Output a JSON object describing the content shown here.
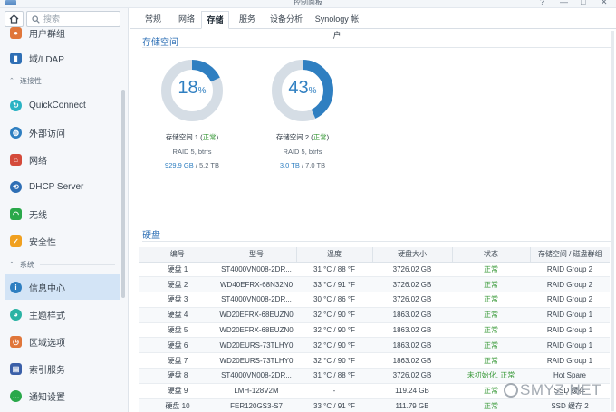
{
  "window": {
    "title": "控制面板",
    "controls": [
      "?",
      "—",
      "□",
      "✕"
    ]
  },
  "sidebar": {
    "search_placeholder": "搜索",
    "items": [
      {
        "label": "用户群组",
        "icon": "users-icon",
        "color": "#e0763a"
      },
      {
        "label": "域/LDAP",
        "icon": "directory-icon",
        "color": "#2f6fb5"
      },
      {
        "label": "QuickConnect",
        "icon": "quickconnect-icon",
        "color": "#2bb3c4"
      },
      {
        "label": "外部访问",
        "icon": "globe-icon",
        "color": "#2f7fc1"
      },
      {
        "label": "网络",
        "icon": "house-network-icon",
        "color": "#d44a3a"
      },
      {
        "label": "DHCP Server",
        "icon": "dhcp-icon",
        "color": "#2f6fb5"
      },
      {
        "label": "无线",
        "icon": "wifi-icon",
        "color": "#2aa84a"
      },
      {
        "label": "安全性",
        "icon": "shield-icon",
        "color": "#f0a020"
      },
      {
        "label": "信息中心",
        "icon": "info-icon",
        "color": "#2f7fc1"
      },
      {
        "label": "主题样式",
        "icon": "palette-icon",
        "color": "#2bb3a4"
      },
      {
        "label": "区域选项",
        "icon": "calendar-clock-icon",
        "color": "#e0763a"
      },
      {
        "label": "索引服务",
        "icon": "index-icon",
        "color": "#3a5fa8"
      },
      {
        "label": "通知设置",
        "icon": "chat-bubble-icon",
        "color": "#2aa84a"
      }
    ],
    "headers": {
      "connectivity": "连接性",
      "system": "系统"
    }
  },
  "tabs": [
    "常规",
    "网络",
    "存储",
    "服务",
    "设备分析",
    "Synology 帐户"
  ],
  "active_tab": 2,
  "storage": {
    "title": "存储空间",
    "volumes": [
      {
        "percent": 18,
        "unit": "%",
        "name": "存储空间 1",
        "status": "正常",
        "raid": "RAID 5, btrfs",
        "used": "929.9 GB",
        "total": "5.2 TB"
      },
      {
        "percent": 43,
        "unit": "%",
        "name": "存储空间 2",
        "status": "正常",
        "raid": "RAID 5, btrfs",
        "used": "3.0 TB",
        "total": "7.0 TB"
      }
    ]
  },
  "disks": {
    "title": "硬盘",
    "columns": [
      "编号",
      "型号",
      "温度",
      "硬盘大小",
      "状态",
      "存储空间 / 磁盘群组"
    ],
    "rows": [
      [
        "硬盘 1",
        "ST4000VN008-2DR...",
        "31 °C / 88 °F",
        "3726.02 GB",
        "正常",
        "RAID Group 2"
      ],
      [
        "硬盘 2",
        "WD40EFRX-68N32N0",
        "33 °C / 91 °F",
        "3726.02 GB",
        "正常",
        "RAID Group 2"
      ],
      [
        "硬盘 3",
        "ST4000VN008-2DR...",
        "30 °C / 86 °F",
        "3726.02 GB",
        "正常",
        "RAID Group 2"
      ],
      [
        "硬盘 4",
        "WD20EFRX-68EUZN0",
        "32 °C / 90 °F",
        "1863.02 GB",
        "正常",
        "RAID Group 1"
      ],
      [
        "硬盘 5",
        "WD20EFRX-68EUZN0",
        "32 °C / 90 °F",
        "1863.02 GB",
        "正常",
        "RAID Group 1"
      ],
      [
        "硬盘 6",
        "WD20EURS-73TLHY0",
        "32 °C / 90 °F",
        "1863.02 GB",
        "正常",
        "RAID Group 1"
      ],
      [
        "硬盘 7",
        "WD20EURS-73TLHY0",
        "32 °C / 90 °F",
        "1863.02 GB",
        "正常",
        "RAID Group 1"
      ],
      [
        "硬盘 8",
        "ST4000VN008-2DR...",
        "31 °C / 88 °F",
        "3726.02 GB",
        "未初始化, 正常",
        "Hot Spare"
      ],
      [
        "硬盘 9",
        "LMH-128V2M",
        "-",
        "119.24 GB",
        "正常",
        "SSD 缓存"
      ],
      [
        "硬盘 10",
        "FER120GS3-S7",
        "33 °C / 91 °F",
        "111.79 GB",
        "正常",
        "SSD 缓存 2"
      ]
    ]
  },
  "watermark": "SMYZ.NET",
  "colors": {
    "accent": "#2f7fc1",
    "donut_track": "#d5dde5",
    "ok": "#3a9a3a",
    "active_nav": "#d3e4f6"
  }
}
